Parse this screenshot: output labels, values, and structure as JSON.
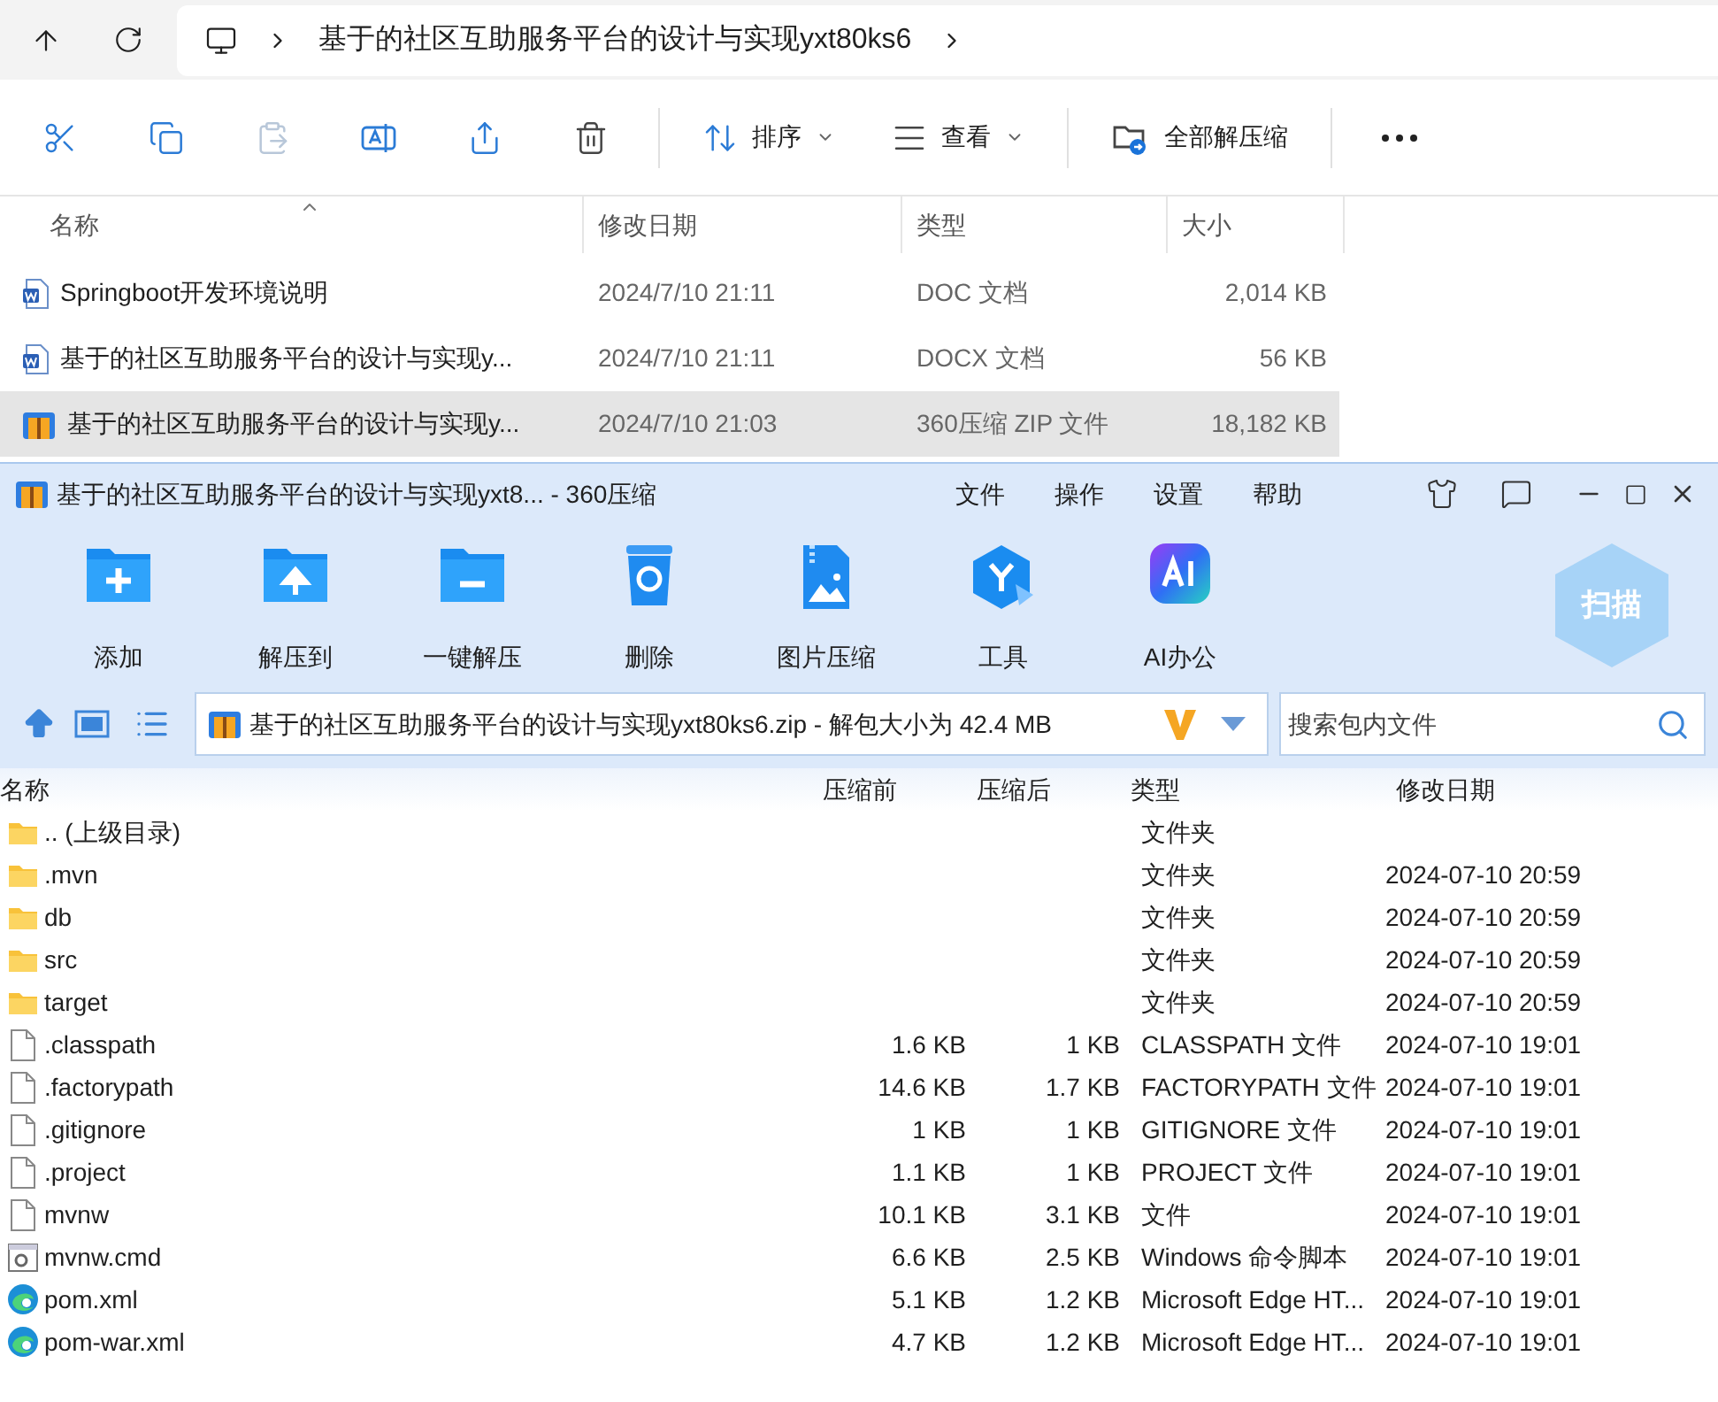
{
  "explorer": {
    "path": "基于的社区互助服务平台的设计与实现yxt80ks6",
    "toolbar": [
      {
        "kind": "cut"
      },
      {
        "kind": "copy"
      },
      {
        "kind": "paste",
        "disabled": true
      },
      {
        "kind": "rename"
      },
      {
        "kind": "share"
      },
      {
        "kind": "delete"
      },
      {
        "kind": "sort",
        "label": "排序"
      },
      {
        "kind": "view",
        "label": "查看"
      },
      {
        "kind": "extract",
        "label": "全部解压缩"
      },
      {
        "kind": "more"
      }
    ],
    "columns": [
      "名称",
      "修改日期",
      "类型",
      "大小"
    ],
    "files": [
      {
        "name": "Springboot开发环境说明",
        "modified": "2024/7/10 21:11",
        "type": "DOC 文档",
        "size": "2,014 KB",
        "kind": "word",
        "selected": false
      },
      {
        "name": "基于的社区互助服务平台的设计与实现y...",
        "modified": "2024/7/10 21:11",
        "type": "DOCX 文档",
        "size": "56 KB",
        "kind": "word",
        "selected": false
      },
      {
        "name": "基于的社区互助服务平台的设计与实现y...",
        "modified": "2024/7/10 21:03",
        "type": "360压缩 ZIP 文件",
        "size": "18,182 KB",
        "kind": "zip",
        "selected": true
      }
    ]
  },
  "archiver": {
    "title": "基于的社区互助服务平台的设计与实现yxt8... - 360压缩",
    "menu": [
      "文件",
      "操作",
      "设置",
      "帮助"
    ],
    "tools": [
      {
        "label": "添加",
        "kind": "add"
      },
      {
        "label": "解压到",
        "kind": "extract"
      },
      {
        "label": "一键解压",
        "kind": "oneclick"
      },
      {
        "label": "删除",
        "kind": "delete"
      },
      {
        "label": "图片压缩",
        "kind": "image"
      },
      {
        "label": "工具",
        "kind": "tools"
      },
      {
        "label": "AI办公",
        "kind": "ai"
      }
    ],
    "scan_label": "扫描",
    "path": "基于的社区互助服务平台的设计与实现yxt80ks6.zip - 解包大小为 42.4 MB",
    "search": {
      "placeholder": "搜索包内文件"
    },
    "columns": [
      "名称",
      "压缩前",
      "压缩后",
      "类型",
      "修改日期"
    ],
    "entries": [
      {
        "name": ".. (上级目录)",
        "type": "文件夹",
        "kind": "folder"
      },
      {
        "name": ".mvn",
        "type": "文件夹",
        "modified": "2024-07-10 20:59",
        "kind": "folder"
      },
      {
        "name": "db",
        "type": "文件夹",
        "modified": "2024-07-10 20:59",
        "kind": "folder"
      },
      {
        "name": "src",
        "type": "文件夹",
        "modified": "2024-07-10 20:59",
        "kind": "folder"
      },
      {
        "name": "target",
        "type": "文件夹",
        "modified": "2024-07-10 20:59",
        "kind": "folder"
      },
      {
        "name": ".classpath",
        "before": "1.6 KB",
        "after": "1 KB",
        "type": "CLASSPATH 文件",
        "modified": "2024-07-10 19:01",
        "kind": "file"
      },
      {
        "name": ".factorypath",
        "before": "14.6 KB",
        "after": "1.7 KB",
        "type": "FACTORYPATH 文件",
        "modified": "2024-07-10 19:01",
        "kind": "file"
      },
      {
        "name": ".gitignore",
        "before": "1 KB",
        "after": "1 KB",
        "type": "GITIGNORE 文件",
        "modified": "2024-07-10 19:01",
        "kind": "file"
      },
      {
        "name": ".project",
        "before": "1.1 KB",
        "after": "1 KB",
        "type": "PROJECT 文件",
        "modified": "2024-07-10 19:01",
        "kind": "file"
      },
      {
        "name": "mvnw",
        "before": "10.1 KB",
        "after": "3.1 KB",
        "type": "文件",
        "modified": "2024-07-10 19:01",
        "kind": "file"
      },
      {
        "name": "mvnw.cmd",
        "before": "6.6 KB",
        "after": "2.5 KB",
        "type": "Windows 命令脚本",
        "modified": "2024-07-10 19:01",
        "kind": "script"
      },
      {
        "name": "pom.xml",
        "before": "5.1 KB",
        "after": "1.2 KB",
        "type": "Microsoft Edge HT...",
        "modified": "2024-07-10 19:01",
        "kind": "edge"
      },
      {
        "name": "pom-war.xml",
        "before": "4.7 KB",
        "after": "1.2 KB",
        "type": "Microsoft Edge HT...",
        "modified": "2024-07-10 19:01",
        "kind": "edge"
      }
    ]
  }
}
